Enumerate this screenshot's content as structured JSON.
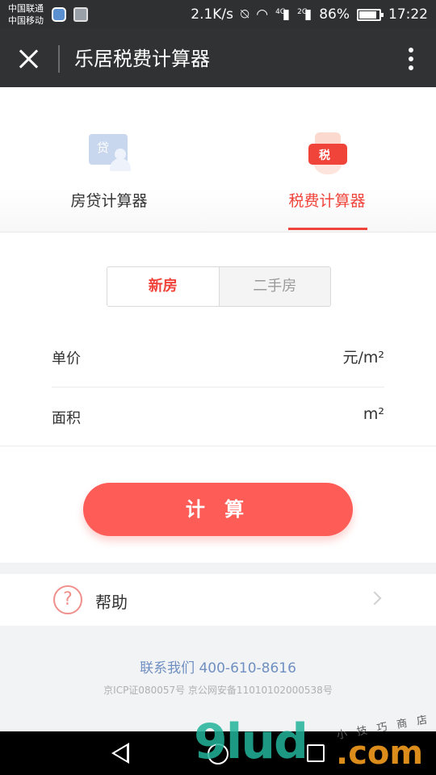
{
  "status_bar": {
    "carrier_1": "中国联通",
    "carrier_2": "中国移动",
    "speed": "2.1K/s",
    "net_4g": "4G",
    "net_2g": "2G",
    "battery_percent": "86%",
    "battery_level": 0.86,
    "time": "17:22"
  },
  "header": {
    "title": "乐居税费计算器"
  },
  "calculator_tabs": [
    {
      "label": "房贷计算器",
      "icon_text": "贷",
      "icon": "loan-card-icon",
      "active": false
    },
    {
      "label": "税费计算器",
      "icon_text": "税",
      "icon": "tax-hand-icon",
      "active": true
    }
  ],
  "house_type": {
    "options": [
      "新房",
      "二手房"
    ],
    "selected": "新房"
  },
  "form": {
    "unit_price": {
      "label": "单价",
      "unit": "元/m²",
      "value": ""
    },
    "area": {
      "label": "面积",
      "unit": "m²",
      "value": ""
    }
  },
  "actions": {
    "calculate_label": "计 算"
  },
  "help": {
    "label": "帮助",
    "icon_text": "?"
  },
  "footer": {
    "contact": "联系我们 400-610-8616",
    "icp": "京ICP证080057号 京公网安备11010102000538号"
  },
  "watermark": {
    "main": "9lud",
    "suffix": ".com",
    "small": "小 技 巧 商 店"
  },
  "colors": {
    "accent": "#f0433a",
    "button": "#fd5c57",
    "link": "#6f8fc2",
    "header_bg": "#313233"
  }
}
